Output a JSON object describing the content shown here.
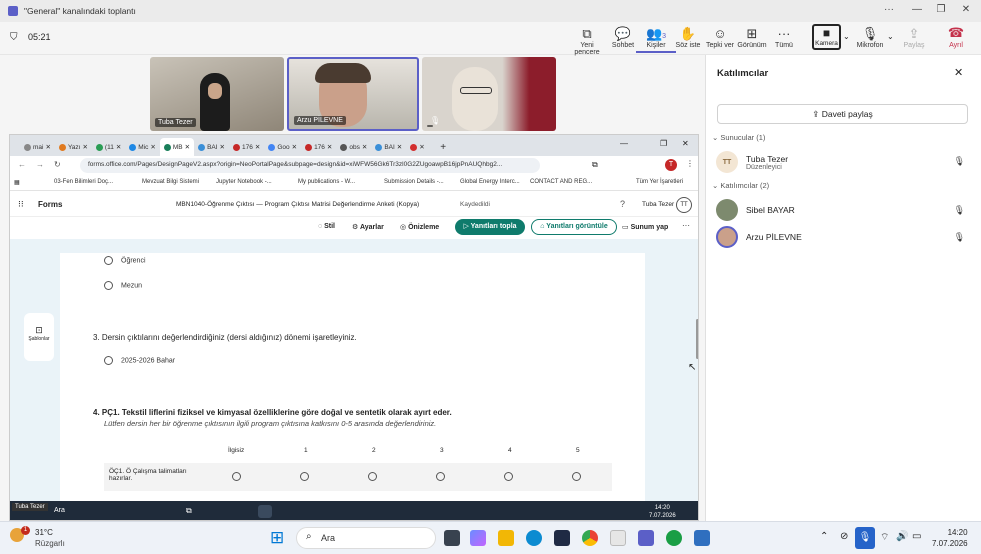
{
  "titlebar": {
    "title": "\"General\" kanalındaki toplantı",
    "controls": [
      "···",
      "—",
      "❐",
      "✕"
    ]
  },
  "meeting": {
    "timer": "05:21",
    "toolbar": [
      {
        "label": "Yeni pencere",
        "icon": "new-window-icon"
      },
      {
        "label": "Sohbet",
        "icon": "chat-icon"
      },
      {
        "label": "Kişiler",
        "icon": "people-icon",
        "badge": "3"
      },
      {
        "label": "Söz iste",
        "icon": "raise-hand-icon"
      },
      {
        "label": "Tepki ver",
        "icon": "react-icon"
      },
      {
        "label": "Görünüm",
        "icon": "view-icon"
      },
      {
        "label": "Tümü",
        "icon": "more-icon"
      }
    ],
    "camera": "Kamera",
    "mic": "Mikrofon",
    "share": "Paylaş",
    "leave": "Ayrıl"
  },
  "videos": [
    {
      "name": "Tuba Tezer"
    },
    {
      "name": "Arzu PİLEVNE"
    },
    {
      "name": ""
    }
  ],
  "panel": {
    "title": "Katılımcılar",
    "share_invite": "Daveti paylaş",
    "presenters_header": "Sunucular (1)",
    "presenter": {
      "initials": "TT",
      "name": "Tuba Tezer",
      "role": "Düzenleyici"
    },
    "attendees_header": "Katılımcılar (2)",
    "attendees": [
      {
        "name": "Sibel BAYAR"
      },
      {
        "name": "Arzu PİLEVNE"
      }
    ]
  },
  "browser": {
    "tabs": [
      "mai",
      "Yazı",
      "(11",
      "Mic",
      "MB",
      "BAI",
      "176",
      "Goo",
      "176",
      "obs",
      "BAI",
      ""
    ],
    "url": "forms.office.com/Pages/DesignPageV2.aspx?origin=NeoPortalPage&subpage=design&id=xiWFW56Gk6Tr3zl0G2ZUgoawpB16jpPnAUQhbg2...",
    "profile": "T",
    "bookmarks": [
      "03-Fen Bilimleri Doç...",
      "Mevzuat Bilgi Sistemi",
      "Jupyter Notebook -...",
      "My publications - W...",
      "Submission Details -...",
      "Global Energy Interc...",
      "CONTACT AND REG...",
      "Tüm Yer İşaretleri"
    ]
  },
  "forms": {
    "app_name": "Forms",
    "doc_title": "MBN1040-Öğrenme Çıktısı — Program Çıktısı Matrisi Değerlendirme Anketi (Kopya)",
    "saved": "Kaydedildi",
    "user": "Tuba Tezer",
    "user_initials": "TT",
    "tools": {
      "style": "Stil",
      "settings": "Ayarlar",
      "preview": "Önizleme",
      "collect": "Yanıtları topla",
      "view_responses": "Yanıtları görüntüle",
      "present": "Sunum yap"
    },
    "templates": "Şablonlar",
    "options_top": [
      "Öğrenci",
      "Mezun"
    ],
    "q3": {
      "number": "3.",
      "text": "Dersin çıktılarını değerlendirdiğiniz (dersi aldığınız) dönemi işaretleyiniz.",
      "options": [
        "2025-2026 Bahar"
      ]
    },
    "q4": {
      "number": "4.",
      "title": "PÇ1. Tekstil liflerini fiziksel ve kimyasal özelliklerine göre doğal ve sentetik olarak ayırt eder.",
      "subtitle": "Lütfen dersin her bir öğrenme çıktısının ilgili program çıktısına katkısını 0-5 arasında değerlendiriniz.",
      "columns": [
        "İlgisiz",
        "1",
        "2",
        "3",
        "4",
        "5"
      ],
      "row1": "ÖÇ1. Ö Çalışma talimatları hazırlar."
    }
  },
  "inner_taskbar": {
    "search": "Ara",
    "time": "14:20",
    "date": "7.07.2026",
    "tooltip": "Tuba Tezer"
  },
  "taskbar": {
    "weather_temp": "31°C",
    "weather_text": "Rüzgarlı",
    "search": "Ara",
    "time": "14:20",
    "date": "7.07.2026",
    "notification": "1"
  }
}
